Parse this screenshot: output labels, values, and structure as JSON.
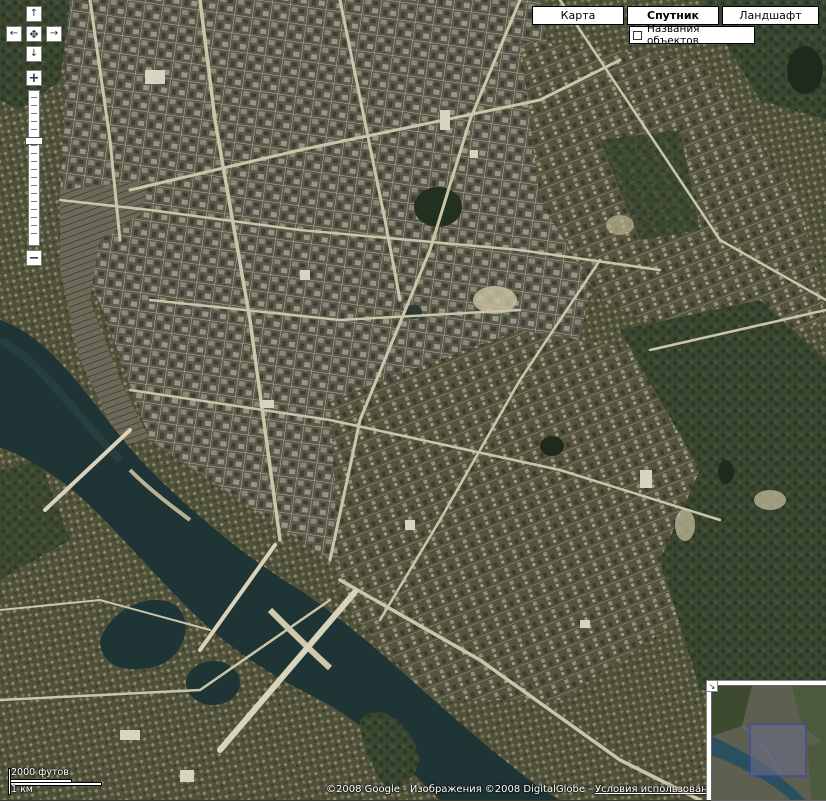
{
  "map_type_buttons": {
    "map": "Карта",
    "satellite": "Спутник",
    "terrain": "Ландшафт",
    "active": "satellite"
  },
  "labels_toggle": {
    "label": "Названия объектов",
    "checked": false
  },
  "scale": {
    "imperial": "2000 футов",
    "metric": "1 км"
  },
  "copyright": {
    "text": "©2008 Google - Изображения ©2008 DigitalGlobe - ",
    "terms": "Условия использования"
  },
  "controls": {
    "pan_up": "↑",
    "pan_down": "↓",
    "pan_left": "←",
    "pan_right": "→",
    "pan_center": "✥",
    "zoom_in": "+",
    "zoom_out": "−",
    "zoom_level_fraction": 0.32
  },
  "icons": {
    "pan": "arrow-icons",
    "zoom": "plus-minus-icons",
    "overview_hide": "collapse-arrow-icon"
  },
  "colors": {
    "river": "#1e3333",
    "urban": "#5e5c4e",
    "vegetation": "#3e4a30",
    "sand": "#c9c2a2"
  }
}
